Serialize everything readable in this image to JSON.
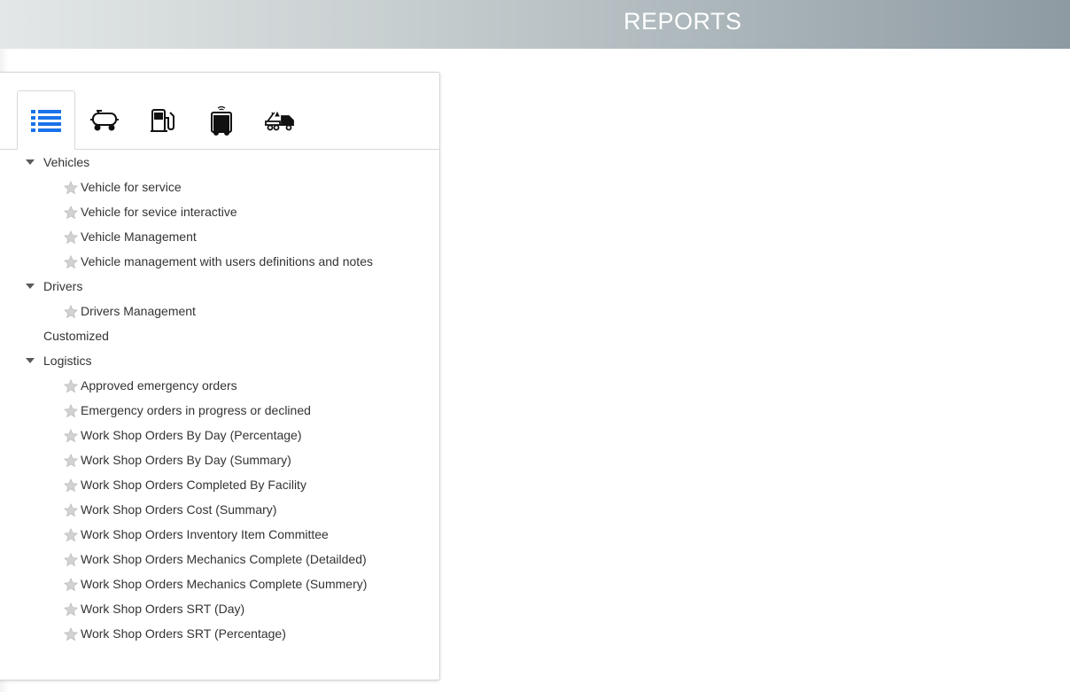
{
  "header": {
    "title": "REPORTS"
  },
  "tabs": [
    {
      "icon": "list-icon",
      "active": true,
      "color": "#1a73e8"
    },
    {
      "icon": "tanker-icon",
      "active": false
    },
    {
      "icon": "fuel-pump-icon",
      "active": false
    },
    {
      "icon": "bus-device-icon",
      "active": false
    },
    {
      "icon": "tow-truck-icon",
      "active": false
    }
  ],
  "tree": {
    "vehicles": {
      "label": "Vehicles",
      "items": [
        "Vehicle for service",
        "Vehicle for sevice interactive",
        "Vehicle Management",
        "Vehicle management with users definitions and notes"
      ]
    },
    "drivers": {
      "label": "Drivers",
      "items": [
        "Drivers Management"
      ]
    },
    "customized": {
      "label": "Customized"
    },
    "logistics": {
      "label": "Logistics",
      "items": [
        "Approved emergency orders",
        "Emergency orders in progress or declined",
        "Work Shop Orders By Day (Percentage)",
        "Work Shop Orders By Day (Summary)",
        "Work Shop Orders Completed By Facility",
        "Work Shop Orders Cost (Summary)",
        "Work Shop Orders Inventory Item Committee",
        "Work Shop Orders Mechanics Complete (Detailded)",
        "Work Shop Orders Mechanics Complete (Summery)",
        "Work Shop Orders SRT (Day)",
        "Work Shop Orders SRT (Percentage)"
      ]
    }
  }
}
